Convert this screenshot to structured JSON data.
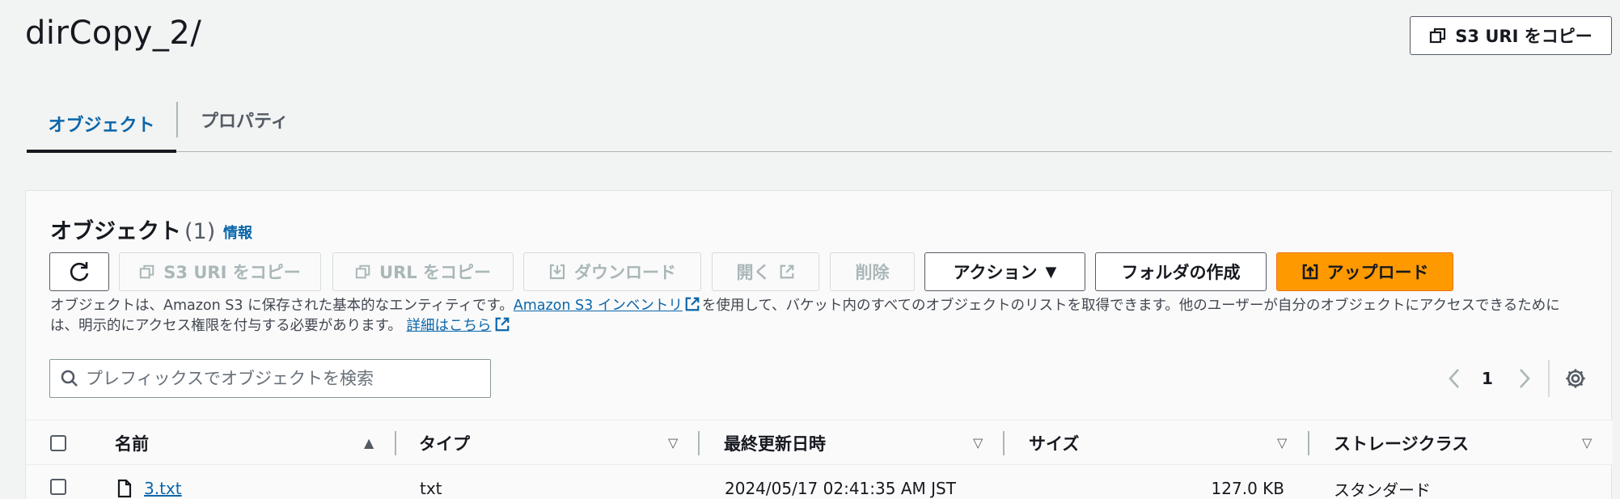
{
  "header": {
    "title": "dirCopy_2/",
    "copy_uri_label": "S3 URI をコピー"
  },
  "tabs": [
    {
      "label": "オブジェクト",
      "active": true
    },
    {
      "label": "プロパティ",
      "active": false
    }
  ],
  "objects_panel": {
    "title": "オブジェクト",
    "count": "(1)",
    "info_label": "情報",
    "toolbar": {
      "refresh_icon": "refresh-icon",
      "copy_s3_uri": "S3 URI をコピー",
      "copy_url": "URL をコピー",
      "download": "ダウンロード",
      "open": "開く",
      "delete": "削除",
      "actions": "アクション",
      "create_folder": "フォルダの作成",
      "upload": "アップロード"
    },
    "description": {
      "part1": "オブジェクトは、Amazon S3 に保存された基本的なエンティティです。",
      "inventory_link": "Amazon S3 インベントリ",
      "part2": "を使用して、バケット内のすべてのオブジェクトのリストを取得できます。他のユーザーが自分のオブジェクトにアクセスできるためには、明示的にアクセス権限を付与する必要があります。",
      "details_link": "詳細はこちら"
    },
    "search": {
      "placeholder": "プレフィックスでオブジェクトを検索",
      "value": ""
    },
    "pagination": {
      "current_page": "1"
    },
    "table": {
      "columns": [
        "名前",
        "タイプ",
        "最終更新日時",
        "サイズ",
        "ストレージクラス"
      ],
      "rows": [
        {
          "name": "3.txt",
          "type": "txt",
          "last_modified": "2024/05/17 02:41:35 AM JST",
          "size": "127.0 KB",
          "storage_class": "スタンダード"
        }
      ]
    }
  },
  "colors": {
    "primary": "#ff9900",
    "link": "#0a66aa",
    "text": "#16191f",
    "disabled": "#aab7b8"
  }
}
